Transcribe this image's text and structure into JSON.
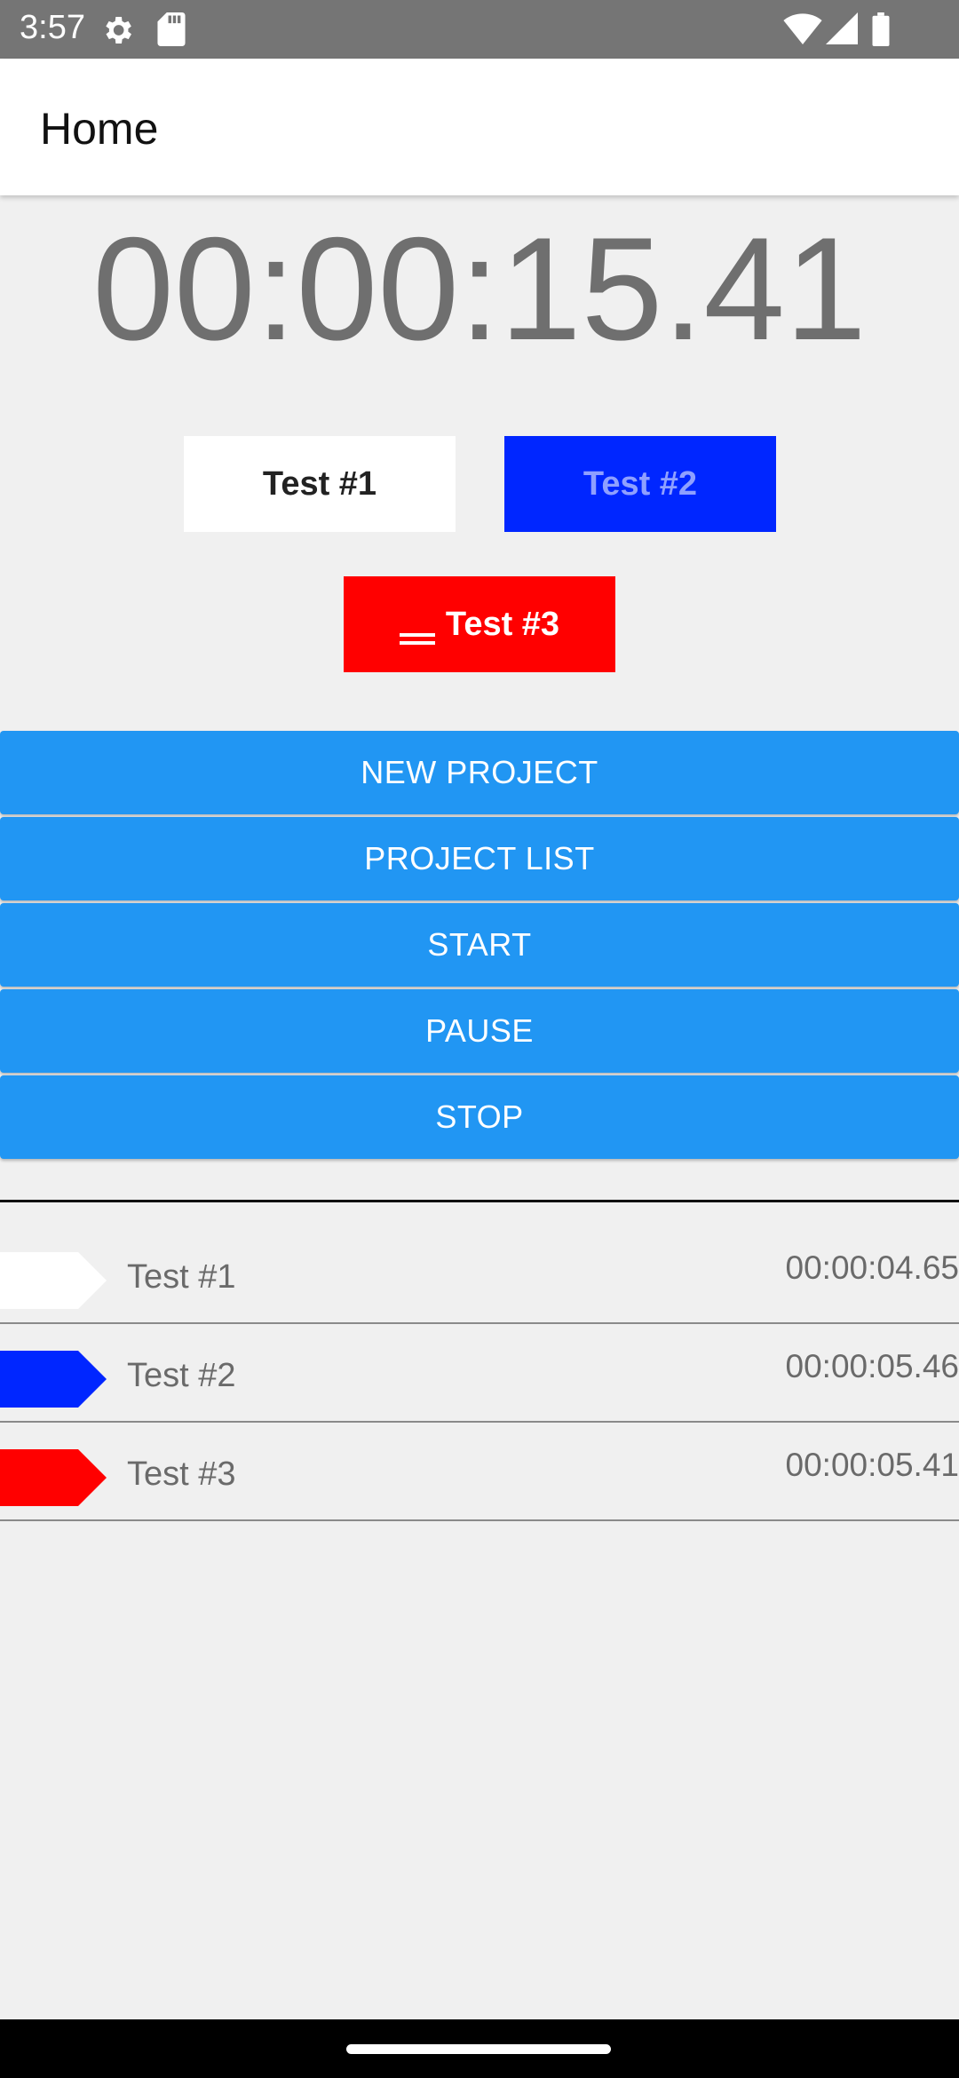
{
  "status_bar": {
    "time": "3:57",
    "icons": [
      "settings-icon",
      "sd-card-icon",
      "wifi-icon",
      "signal-icon",
      "battery-icon"
    ]
  },
  "app_bar": {
    "title": "Home"
  },
  "timer": {
    "value": "00:00:15.41"
  },
  "project_chips": [
    {
      "label": "Test #1",
      "bg": "#ffffff",
      "fg": "#222222"
    },
    {
      "label": "Test #2",
      "bg": "#0026ff",
      "fg": "#8fa0ff"
    },
    {
      "label": "Test #3",
      "bg": "#ff0000",
      "fg": "#ffffff",
      "icon": "menu-icon"
    }
  ],
  "actions": {
    "color": "#2196f3",
    "new_project": "NEW PROJECT",
    "project_list": "PROJECT LIST",
    "start": "START",
    "pause": "PAUSE",
    "stop": "STOP"
  },
  "projects": [
    {
      "name": "Test #1",
      "time": "00:00:04.65",
      "color": "#ffffff"
    },
    {
      "name": "Test #2",
      "time": "00:00:05.46",
      "color": "#0026ff"
    },
    {
      "name": "Test #3",
      "time": "00:00:05.41",
      "color": "#ff0000"
    }
  ]
}
